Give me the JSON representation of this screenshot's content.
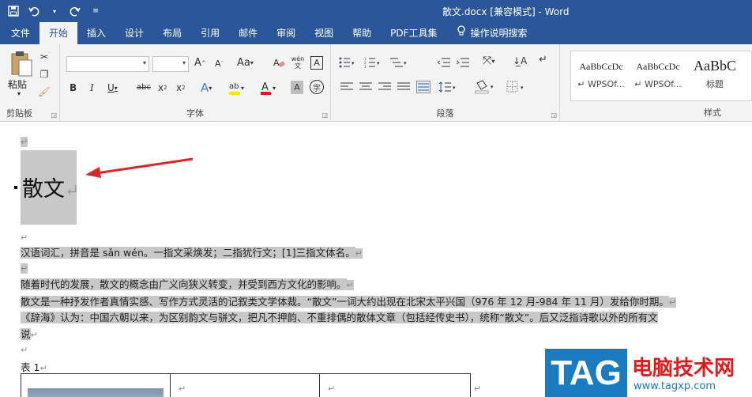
{
  "window": {
    "title": "散文.docx [兼容模式] - Word"
  },
  "tabs": [
    "文件",
    "开始",
    "插入",
    "设计",
    "布局",
    "引用",
    "邮件",
    "审阅",
    "视图",
    "帮助",
    "PDF工具集"
  ],
  "tell_me": "操作说明搜索",
  "ribbon": {
    "clipboard": {
      "label": "剪贴板",
      "paste": "粘贴"
    },
    "font": {
      "label": "字体",
      "aa_label": "Aa",
      "wen": "wén\n文"
    },
    "paragraph": {
      "label": "段落"
    },
    "styles": {
      "label": "样式",
      "items": [
        {
          "preview": "AaBbCcDc",
          "name": "↵ WPSOf..."
        },
        {
          "preview": "AaBbCcDc",
          "name": "↵ WPSOf..."
        },
        {
          "preview": "AaBbC",
          "name": "标题"
        }
      ]
    }
  },
  "document": {
    "heading": "散文",
    "para1": "汉语词汇，拼音是 sǎn wén。一指文采焕发；二指犹行文；[1]三指文体名。",
    "para2": "随着时代的发展，散文的概念由广义向狭义转变，并受到西方文化的影响。",
    "para3": "散文是一种抒发作者真情实感、写作方式灵活的记叙类文学体裁。“散文”一词大约出现在北宋太平兴国（976 年 12 月-984 年 11 月）发给你时期。",
    "para4": "《辞海》认为：中国六朝以来，为区别韵文与骈文，把凡不押韵、不重排偶的散体文章（包括经传史书），统称“散文”。后又泛指诗歌以外的所有文",
    "para4b": "说",
    "table_caption": "表  1",
    "mark": "↵"
  },
  "watermark": {
    "tag": "TAG",
    "cn": "电脑技术网",
    "url": "www.tagxp.com"
  },
  "colors": {
    "accent": "#2b579a",
    "highlight": "#c8c8c8",
    "arrow": "#d9262b"
  }
}
